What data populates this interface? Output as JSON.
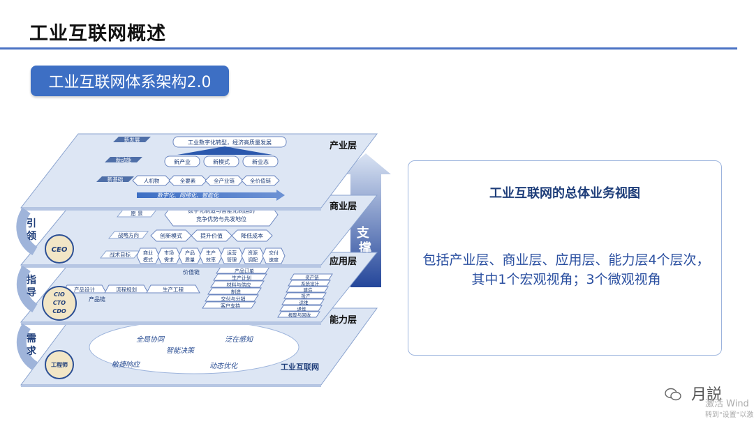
{
  "page": {
    "title": "工业互联网概述",
    "subtitle": "工业互联网体系架构2.0"
  },
  "diagram": {
    "layers": [
      "产业层",
      "商业层",
      "应用层",
      "能力层"
    ],
    "support_label": "支撑",
    "industry": {
      "rows": [
        "新发展",
        "新动能",
        "新基础"
      ],
      "goal": "工业数字化转型，经济高质量发展",
      "dynamics": [
        "新产业",
        "新模式",
        "新业态"
      ],
      "foundation": [
        "人机物",
        "全要素",
        "全产业链",
        "全价值链"
      ],
      "arrow_text": "数字化、网络化、智能化"
    },
    "business": {
      "rows": [
        "愿  景",
        "战略方向",
        "战术目标"
      ],
      "vision": [
        "数字化制造与智能化制运的",
        "竞争优势与先发地位"
      ],
      "directions": [
        "创新模式",
        "提升价值",
        "降低成本"
      ],
      "tactics": [
        [
          "商业",
          "模式"
        ],
        [
          "市场",
          "需求"
        ],
        [
          "产品",
          "质量"
        ],
        [
          "生产",
          "效率"
        ],
        [
          "运营",
          "管理"
        ],
        [
          "资源",
          "调配"
        ],
        [
          "交付",
          "速度"
        ]
      ]
    },
    "application": {
      "value_chain": "价值链",
      "product_chain": "产品链",
      "product_items": [
        "产品设计",
        "流程规划",
        "生产工程"
      ],
      "value_items": [
        "产品订单",
        "生产计划",
        "材料与供应",
        "制造",
        "交付与分销",
        "客户支持"
      ],
      "asset_items": [
        "资产链",
        "系统设计",
        "建造",
        "投产",
        "运维",
        "退役",
        "报废与回收"
      ]
    },
    "capability": {
      "clouds": [
        "全局协同",
        "泛在感知",
        "智能决策",
        "敏捷响应",
        "动态优化"
      ],
      "label": "工业互联网"
    },
    "sides": {
      "lead": [
        "引",
        "领"
      ],
      "lead_role": "CEO",
      "guide": [
        "指",
        "导"
      ],
      "guide_roles": [
        "CIO",
        "CTO",
        "CDO"
      ],
      "demand": [
        "需",
        "求"
      ],
      "demand_role": "工程师"
    }
  },
  "info": {
    "title": "工业互联网的总体业务视图",
    "text": "包括产业层、商业层、应用层、能力层4个层次，其中1个宏观视角；3个微观视角"
  },
  "watermark": {
    "brand": "月説",
    "win_line1": "激活 Wind",
    "win_line2": "转到\"设置\"以激"
  },
  "colors": {
    "accent": "#3d6fc4",
    "layer_fill": "#dde6f4",
    "dark_blue": "#1f3e7a"
  }
}
